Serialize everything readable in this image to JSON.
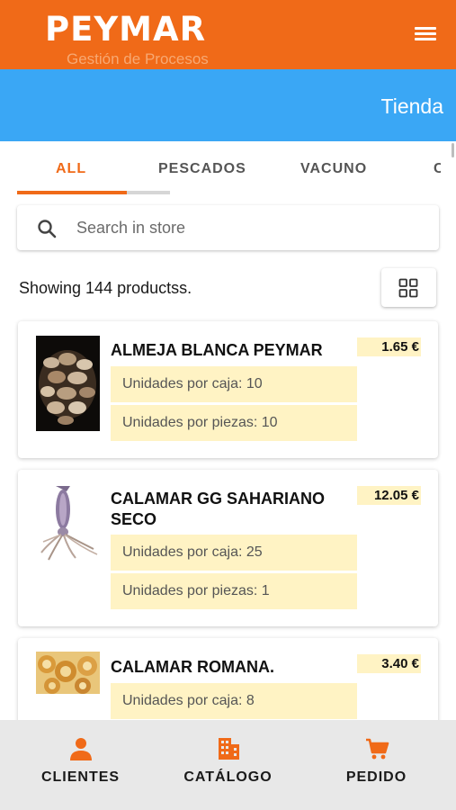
{
  "header": {
    "brand": "PEYMAR",
    "subtitle": "Gestión de Procesos",
    "menu_icon": "hamburger-menu-icon",
    "accent_color": "#f06a18"
  },
  "subheader": {
    "title": "Tienda",
    "color": "#3aa7f5"
  },
  "tabs": [
    {
      "label": "ALL",
      "active": true
    },
    {
      "label": "PESCADOS",
      "active": false
    },
    {
      "label": "VACUNO",
      "active": false
    },
    {
      "label": "C",
      "active": false
    }
  ],
  "search": {
    "placeholder": "Search in store",
    "value": ""
  },
  "results": {
    "count_text": "Showing 144 productss.",
    "view_toggle_icon": "grid-view-icon"
  },
  "products": [
    {
      "name": "ALMEJA BLANCA PEYMAR",
      "price": "1.65 €",
      "caja": "Unidades por caja: 10",
      "piezas": "Unidades por piezas: 10"
    },
    {
      "name": "CALAMAR GG SAHARIANO SECO",
      "price": "12.05 €",
      "caja": "Unidades por caja: 25",
      "piezas": "Unidades por piezas: 1"
    },
    {
      "name": "CALAMAR ROMANA.",
      "price": "3.40 €",
      "caja": "Unidades por caja: 8",
      "piezas": ""
    }
  ],
  "bottom_nav": [
    {
      "label": "CLIENTES",
      "icon": "person-icon"
    },
    {
      "label": "CATÁLOGO",
      "icon": "building-icon"
    },
    {
      "label": "PEDIDO",
      "icon": "cart-icon"
    }
  ]
}
